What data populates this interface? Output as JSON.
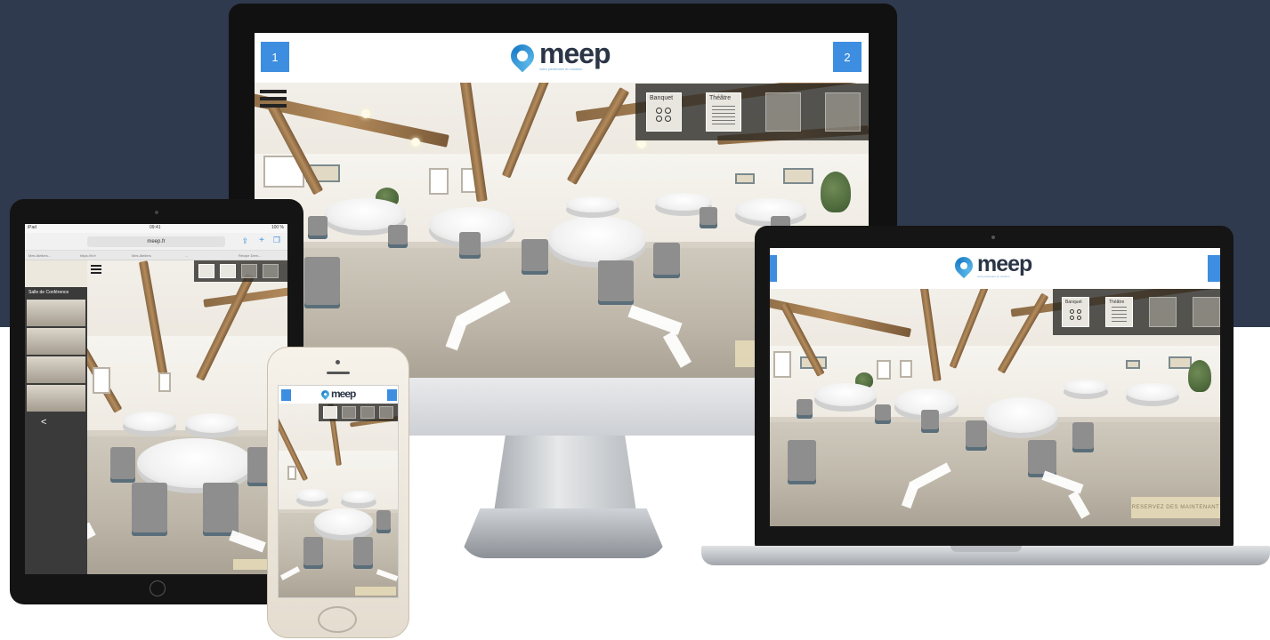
{
  "brand": {
    "name": "meep",
    "tagline": "votre partenaire en solution",
    "accent_color": "#3d8ee0",
    "background_color": "#2f3a4e"
  },
  "desktop": {
    "left_button": "1",
    "right_button": "2",
    "layouts": [
      {
        "label": "Banquet",
        "icon": "banquet-layout-icon",
        "selected": true
      },
      {
        "label": "Théâtre",
        "icon": "theatre-layout-icon",
        "selected": true
      },
      {
        "label": "",
        "icon": "layout-3-icon",
        "selected": false
      },
      {
        "label": "",
        "icon": "layout-4-icon",
        "selected": false
      }
    ]
  },
  "laptop": {
    "layouts": [
      {
        "label": "Banquet"
      },
      {
        "label": "Théâtre"
      },
      {
        "label": ""
      },
      {
        "label": ""
      }
    ],
    "cta": "RESERVEZ DES MAINTENANT"
  },
  "tablet": {
    "status_left": "iPad",
    "status_time": "09:41",
    "status_right": "100 %",
    "url": "meep.fr",
    "tabs": [
      "Mes Ateliers...",
      "https://fr.fr",
      "Mes Ateliers",
      "...",
      "Recipe Dem..."
    ],
    "side_title": "Salle de Conférence"
  },
  "phone": {
    "cta": ""
  }
}
